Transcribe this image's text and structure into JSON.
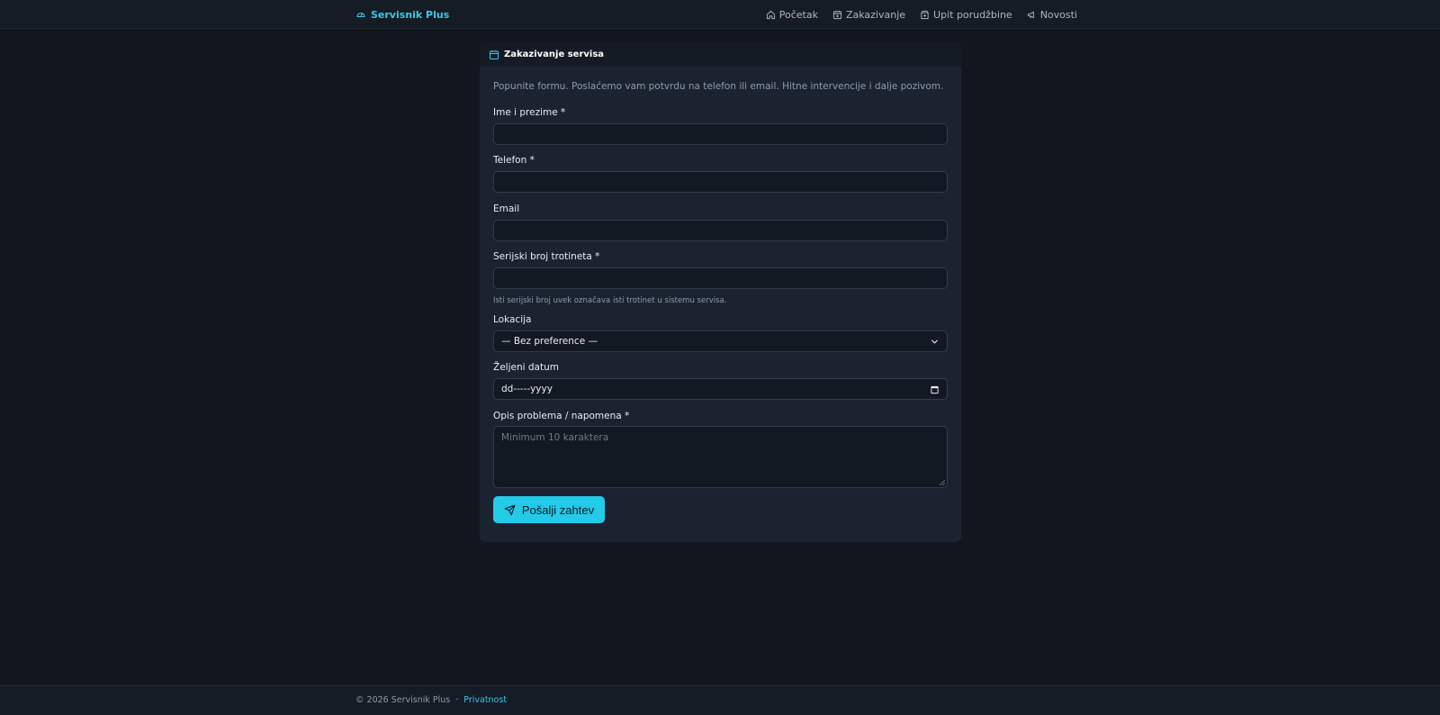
{
  "brand": {
    "name": "Servisnik Plus",
    "color": "#38c9e6"
  },
  "nav": {
    "items": [
      {
        "label": "Početak",
        "icon": "home-icon"
      },
      {
        "label": "Zakazivanje",
        "icon": "calendar-plus-icon"
      },
      {
        "label": "Upit porudžbine",
        "icon": "package-icon"
      },
      {
        "label": "Novosti",
        "icon": "megaphone-icon"
      }
    ]
  },
  "form": {
    "title": "Zakazivanje servisa",
    "intro": "Popunite formu. Poslaćemo vam potvrdu na telefon ili email. Hitne intervencije i dalje pozivom.",
    "name_label": "Ime i prezime *",
    "name_value": "",
    "phone_label": "Telefon *",
    "phone_value": "",
    "email_label": "Email",
    "email_value": "",
    "serial_label": "Serijski broj trotineta *",
    "serial_value": "",
    "serial_hint": "Isti serijski broj uvek označava isti trotinet u sistemu servisa.",
    "location_label": "Lokacija",
    "location_selected": "— Bez preference —",
    "date_label": "Željeni datum",
    "date_placeholder": "dd-----yyyy",
    "desc_label": "Opis problema / napomena *",
    "desc_placeholder": "Minimum 10 karaktera",
    "submit_label": "Pošalji zahtev"
  },
  "footer": {
    "copyright": "© 2026 Servisnik Plus",
    "separator": "·",
    "privacy": "Privatnost"
  },
  "colors": {
    "background": "#12171f",
    "card": "#1b2330",
    "accent": "#23cbe8"
  }
}
